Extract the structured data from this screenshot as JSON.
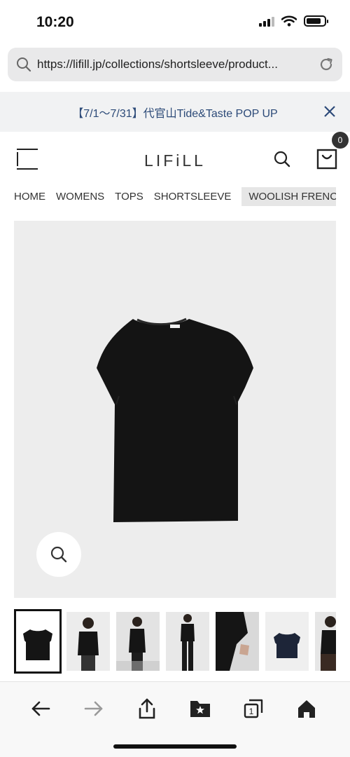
{
  "status_bar": {
    "time": "10:20",
    "signal_bars": 3,
    "battery_level": 0.85
  },
  "url_bar": {
    "url": "https://lifill.jp/collections/shortsleeve/product..."
  },
  "banner": {
    "text": "【7/1～7/31】代官山Tide&Taste POP UP",
    "text_color": "#2c4a78"
  },
  "header": {
    "logo": "LIFiLL",
    "cart_count": "0"
  },
  "breadcrumb": {
    "items": [
      "HOME",
      "WOMENS",
      "TOPS",
      "SHORTSLEEVE"
    ],
    "current": "WOOLISH FRENCH S"
  },
  "product": {
    "image_icon": "black-tshirt-image",
    "zoom_icon": "search-icon",
    "thumbnail_count": 7,
    "selected_thumbnail": 1
  },
  "toolbar": {
    "buttons": [
      "back-icon",
      "forward-icon",
      "share-icon",
      "bookmarks-icon",
      "tabs-icon",
      "home-icon"
    ],
    "tab_count": "1"
  }
}
